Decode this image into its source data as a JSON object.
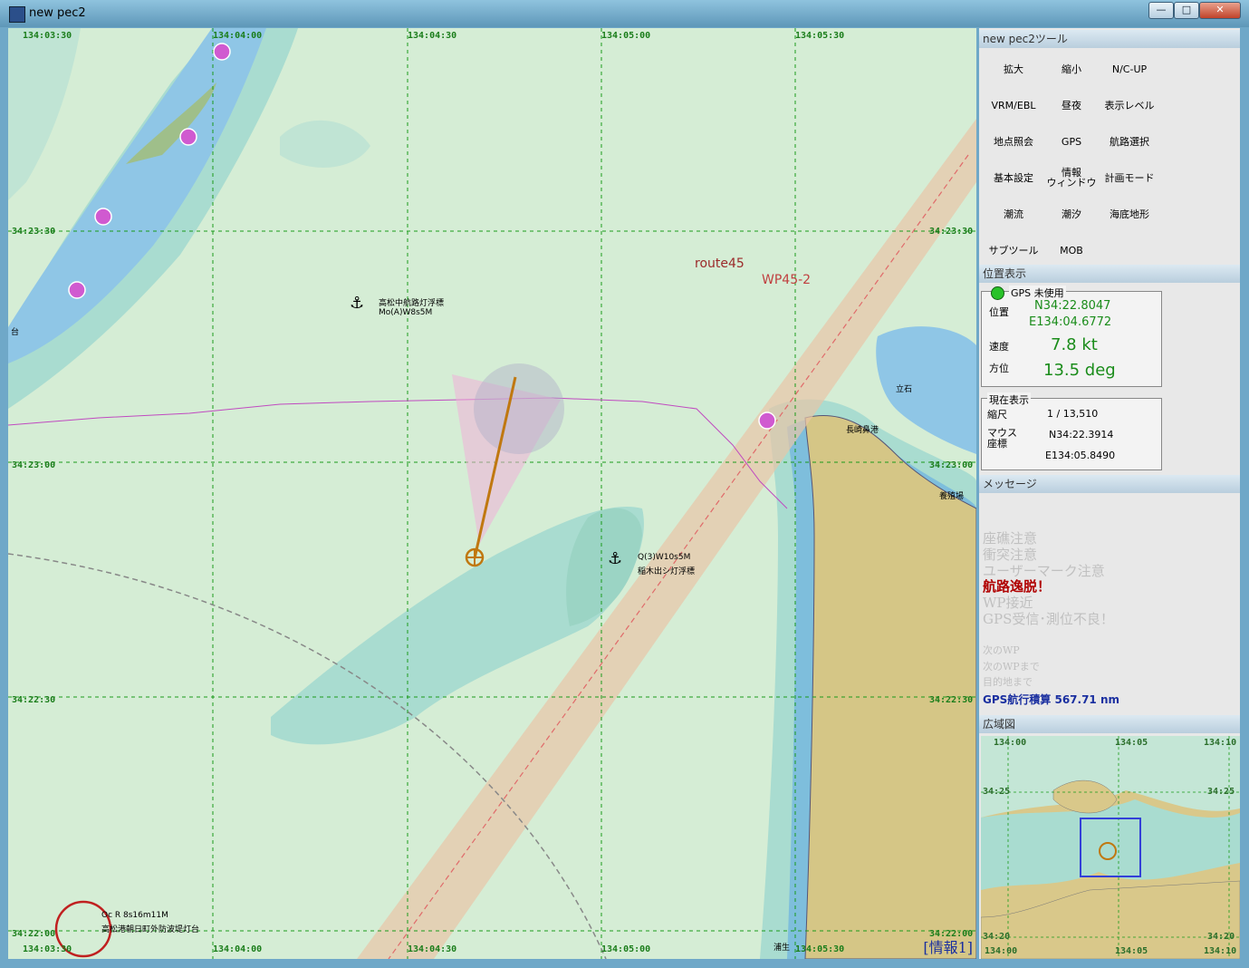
{
  "window": {
    "title": "new pec2",
    "buttons": {
      "minimize": "—",
      "maximize": "□",
      "close": "✕"
    }
  },
  "chart": {
    "lon_top": [
      "134:03:30",
      "134:04:00",
      "134:04:30",
      "134:05:00",
      "134:05:30"
    ],
    "lon_bottom": [
      "134:03:30",
      "134:04:00",
      "134:04:30",
      "134:05:00",
      "134:05:30"
    ],
    "lat_left": [
      "34:23:30",
      "34:23:00",
      "34:22:30",
      "34:22:00"
    ],
    "lat_right": [
      "34:23:30",
      "34:23:00",
      "34:22:30",
      "34:22:00"
    ],
    "route_name": "route45",
    "waypoint_name": "WP45-2",
    "buoy1_name": "高松中航路灯浮標",
    "buoy1_light": "Mo(A)W8s5M",
    "buoy2_light": "Q(3)W10s5M",
    "buoy2_name": "稲木出シ灯浮標",
    "lighthouse_light": "Oc R 8s16m11M",
    "lighthouse_name": "高松港朝日町外防波堤灯台",
    "place_tateishi": "立石",
    "place_nagasaki": "長崎鼻港",
    "place_yoshoku": "養殖場",
    "place_dai": "台",
    "place_ura": "浦生",
    "info_tag": "[情報1]",
    "colors": {
      "sea_shallow": "#d5edd5",
      "sea_mid": "#a9dcd0",
      "sea_deep": "#8fc6e6",
      "land": "#d5c686",
      "route": "#e8c4a6"
    }
  },
  "tools": {
    "header": "new pec2ツール",
    "buttons": [
      "拡大",
      "縮小",
      "N/C-UP",
      "VRM/EBL",
      "昼夜",
      "表示レベル",
      "地点照会",
      "GPS",
      "航路選択",
      "基本設定",
      "情報\nウィンドウ",
      "計画モード",
      "潮流",
      "潮汐",
      "海底地形",
      "サブツール",
      "MOB"
    ]
  },
  "position": {
    "header": "位置表示",
    "gps_status": "GPS 未使用",
    "pos_label": "位置",
    "lat": "N34:22.8047",
    "lon": "E134:04.6772",
    "speed_label": "速度",
    "speed": "7.8 kt",
    "heading_label": "方位",
    "heading": "13.5 deg"
  },
  "current": {
    "legend": "現在表示",
    "scale_label": "縮尺",
    "scale": "1 / 13,510",
    "mouse_label": "マウス\n座標",
    "mouse_lat": "N34:22.3914",
    "mouse_lon": "E134:05.8490"
  },
  "messages": {
    "header": "メッセージ",
    "items": [
      "座礁注意",
      "衝突注意",
      "ユーザーマーク注意",
      "航路逸脱！",
      "WP接近",
      "GPS受信･測位不良！"
    ],
    "next_wp": "次のWP",
    "to_next_wp": "次のWPまで",
    "to_dest": "目的地まで",
    "gps_total": "GPS航行積算 567.71 nm"
  },
  "overview": {
    "header": "広域図",
    "top": [
      "134:00",
      "134:05",
      "134:10"
    ],
    "bottom": [
      "134:00",
      "134:05",
      "134:10"
    ],
    "left": [
      "34:25",
      "34:20"
    ],
    "right": [
      "34:25",
      "34:20"
    ]
  }
}
